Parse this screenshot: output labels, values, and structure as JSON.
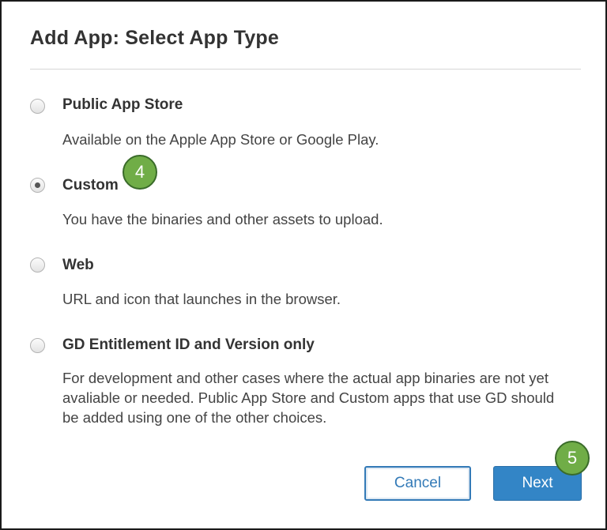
{
  "dialog": {
    "title": "Add App: Select App Type"
  },
  "options": [
    {
      "label": "Public App Store",
      "description": "Available on the Apple App Store or Google Play.",
      "selected": false
    },
    {
      "label": "Custom",
      "description": "You have the binaries and other assets to upload.",
      "selected": true
    },
    {
      "label": "Web",
      "description": "URL and icon that launches in the browser.",
      "selected": false
    },
    {
      "label": "GD Entitlement ID and Version only",
      "description": "For development and other cases where the actual app binaries are not yet avaliable or needed. Public App Store and Custom apps that use GD should be added using one of the other choices.",
      "selected": false
    }
  ],
  "callouts": {
    "step_4": "4",
    "step_5": "5"
  },
  "buttons": {
    "cancel_label": "Cancel",
    "next_label": "Next"
  },
  "colors": {
    "callout": "#70ad47",
    "primary": "#3385c6",
    "link": "#337ab7"
  }
}
